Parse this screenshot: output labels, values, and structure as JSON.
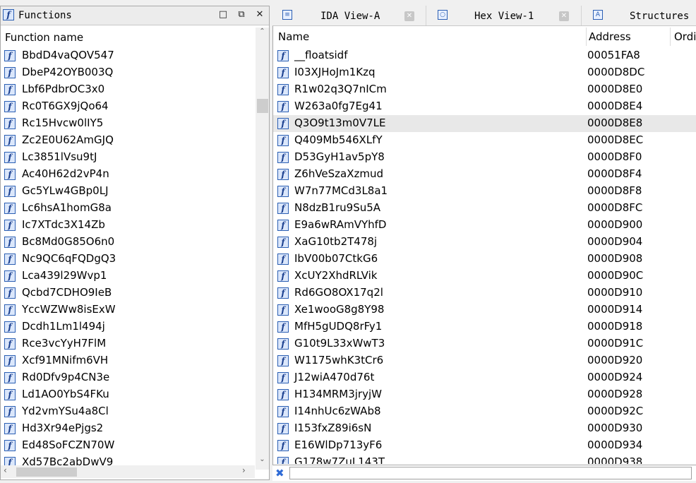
{
  "functions_panel": {
    "title": "Functions",
    "icon": "function-icon",
    "column_header": "Function name",
    "title_buttons": [
      "maximize",
      "float",
      "close"
    ],
    "items": [
      "BbdD4vaQOV547",
      "DbeP42OYB003Q",
      "Lbf6PdbrOC3x0",
      "Rc0T6GX9jQo64",
      "Rc15Hvcw0lIY5",
      "Zc2E0U62AmGJQ",
      "Lc3851lVsu9tJ",
      "Ac40H62d2vP4n",
      "Gc5YLw4GBp0LJ",
      "Lc6hsA1homG8a",
      "Ic7XTdc3X14Zb",
      "Bc8Md0G85O6n0",
      "Nc9QC6qFQDgQ3",
      "Lca439l29Wvp1",
      "Qcbd7CDHO9IeB",
      "YccWZWw8isExW",
      "Dcdh1Lm1l494j",
      "Rce3vcYyH7FlM",
      "Xcf91MNifm6VH",
      "Rd0Dfv9p4CN3e",
      "Ld1AO0YbS4FKu",
      "Yd2vmYSu4a8Cl",
      "Hd3Xr94ePjgs2",
      "Ed48SoFCZN70W",
      "Xd57Bc2abDwV9"
    ]
  },
  "tabs": [
    {
      "label": "IDA View-A",
      "icon": "ida-view-icon",
      "close_icon": "close-icon"
    },
    {
      "label": "Hex View-1",
      "icon": "hex-view-icon",
      "close_icon": "close-icon"
    },
    {
      "label": "Structures",
      "icon": "structures-icon"
    }
  ],
  "exports_table": {
    "columns": [
      "Name",
      "Address",
      "Ordi"
    ],
    "selected_row_index": 4,
    "rows": [
      {
        "name": "__floatsidf",
        "address": "00051FA8"
      },
      {
        "name": "I03XJHoJm1Kzq",
        "address": "0000D8DC"
      },
      {
        "name": "R1w02q3Q7nICm",
        "address": "0000D8E0"
      },
      {
        "name": "W263a0fg7Eg41",
        "address": "0000D8E4"
      },
      {
        "name": "Q3O9t13m0V7LE",
        "address": "0000D8E8"
      },
      {
        "name": "Q409Mb546XLfY",
        "address": "0000D8EC"
      },
      {
        "name": "D53GyH1av5pY8",
        "address": "0000D8F0"
      },
      {
        "name": "Z6hVeSzaXzmud",
        "address": "0000D8F4"
      },
      {
        "name": "W7n77MCd3L8a1",
        "address": "0000D8F8"
      },
      {
        "name": "N8dzB1ru9Su5A",
        "address": "0000D8FC"
      },
      {
        "name": "E9a6wRAmVYhfD",
        "address": "0000D900"
      },
      {
        "name": "XaG10tb2T478j",
        "address": "0000D904"
      },
      {
        "name": "IbV00b07CtkG6",
        "address": "0000D908"
      },
      {
        "name": "XcUY2XhdRLVik",
        "address": "0000D90C"
      },
      {
        "name": "Rd6GO8OX17q2l",
        "address": "0000D910"
      },
      {
        "name": "Xe1wooG8g8Y98",
        "address": "0000D914"
      },
      {
        "name": "MfH5gUDQ8rFy1",
        "address": "0000D918"
      },
      {
        "name": "G10t9L33xWwT3",
        "address": "0000D91C"
      },
      {
        "name": "W1175whK3tCr6",
        "address": "0000D920"
      },
      {
        "name": "J12wiA470d76t",
        "address": "0000D924"
      },
      {
        "name": "H134MRM3jryjW",
        "address": "0000D928"
      },
      {
        "name": "I14nhUc6zWAb8",
        "address": "0000D92C"
      },
      {
        "name": "I153fxZ89i6sN",
        "address": "0000D930"
      },
      {
        "name": "E16WlDp713yF6",
        "address": "0000D934"
      },
      {
        "name": "G178w7ZuL143T",
        "address": "0000D938"
      }
    ]
  },
  "filter": {
    "value": "",
    "clear_icon": "clear-filter-icon"
  },
  "colors": {
    "selection": "#e8e8e8",
    "icon_border": "#2b5fb3",
    "icon_fill": "#dbe7fb"
  }
}
